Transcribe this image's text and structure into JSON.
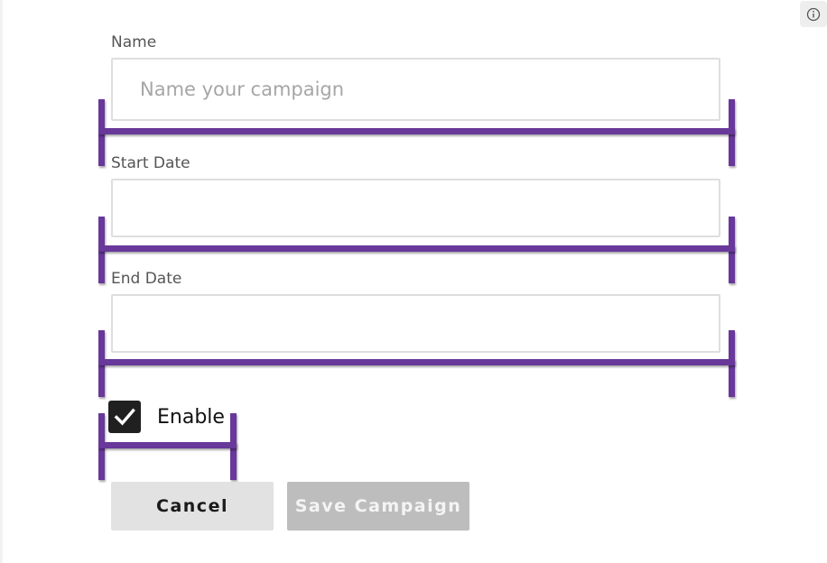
{
  "form": {
    "name": {
      "label": "Name",
      "placeholder": "Name your campaign",
      "value": ""
    },
    "start_date": {
      "label": "Start Date",
      "value": ""
    },
    "end_date": {
      "label": "End Date",
      "value": ""
    },
    "enable": {
      "label": "Enable",
      "checked": true
    }
  },
  "buttons": {
    "cancel_label": "Cancel",
    "save_label": "Save Campaign"
  },
  "icons": {
    "info": "info-icon",
    "checkmark": "checkmark-icon"
  },
  "colors": {
    "annotation": "#68389a",
    "checkbox": "#202020",
    "save_disabled": "#bdbdbd",
    "cancel": "#e2e2e2"
  }
}
